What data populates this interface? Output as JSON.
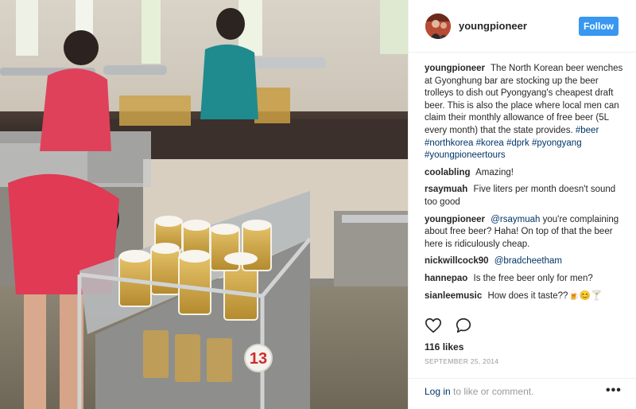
{
  "post": {
    "username": "youngpioneer",
    "follow_label": "Follow",
    "caption": {
      "user": "youngpioneer",
      "text": "The North Korean beer wenches at Gyonghung bar are stocking up the beer trolleys to dish out Pyongyang's cheapest draft beer. This is also the place where local men can claim their monthly allowance of free beer (5L every month) that the state provides.",
      "hashtags": [
        "#beer",
        "#northkorea",
        "#korea",
        "#dprk",
        "#pyongyang",
        "#youngpioneertours"
      ]
    },
    "comments": [
      {
        "user": "coolabling",
        "text": "Amazing!"
      },
      {
        "user": "rsaymuah",
        "text": "Five liters per month doesn't sound too good"
      },
      {
        "user": "youngpioneer",
        "mention": "@rsaymuah",
        "text": "you're complaining about free beer? Haha! On top of that the beer here is ridiculously cheap."
      },
      {
        "user": "nickwillcock90",
        "mention": "@bradcheetham",
        "text": ""
      },
      {
        "user": "hannepao",
        "text": "Is the free beer only for men?"
      },
      {
        "user": "sianleemusic",
        "text": "How does it taste??🍺😊🍸"
      }
    ],
    "likes": "116 likes",
    "date": "SEPTEMBER 25, 2014",
    "login_link": "Log in",
    "login_suffix": "to like or comment.",
    "more_label": "•••",
    "trolley_number": "13"
  },
  "icons": {
    "like": "heart-icon",
    "comment": "comment-bubble-icon",
    "more": "more-options-icon"
  },
  "colors": {
    "follow_button": "#3897f0",
    "link": "#003569",
    "muted": "#999999"
  }
}
